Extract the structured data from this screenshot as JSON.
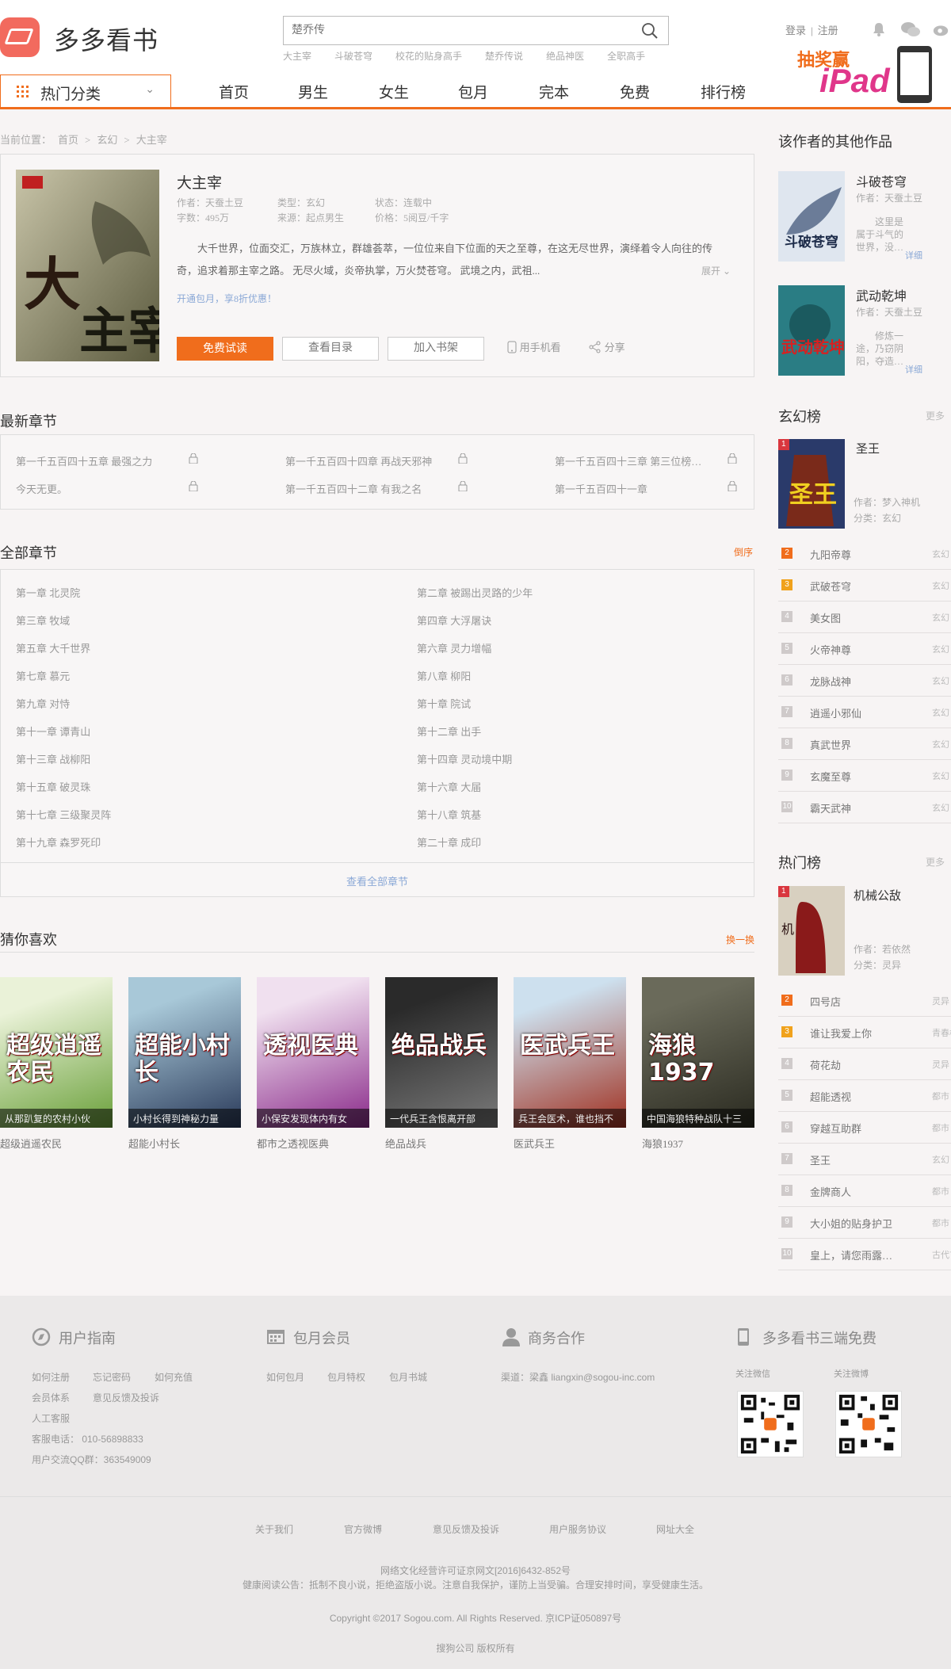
{
  "header": {
    "logo_text": "多多看书",
    "search_placeholder": "楚乔传",
    "hot_words": [
      "大主宰",
      "斗破苍穹",
      "校花的贴身高手",
      "楚乔传说",
      "绝品神医",
      "全职高手"
    ],
    "login": "登录",
    "register": "注册",
    "promo_text1": "抽奖赢",
    "promo_text2": "iPad"
  },
  "nav": {
    "category_label": "热门分类",
    "items": [
      "首页",
      "男生",
      "女生",
      "包月",
      "完本",
      "免费",
      "排行榜"
    ]
  },
  "breadcrumb": [
    "当前位置：",
    "首页",
    ">",
    "玄幻",
    ">",
    "大主宰"
  ],
  "book": {
    "title": "大主宰",
    "author": "作者：天蚕土豆",
    "type": "类型：玄幻",
    "status": "状态：连载中",
    "words": "字数：495万",
    "source": "来源：起点男生",
    "price": "价格：5阅豆/千字",
    "intro": "大千世界，位面交汇，万族林立，群雄荟萃，一位位来自下位面的天之至尊，在这无尽世界，演绎着令人向往的传奇，追求着那主宰之路。        无尽火域，炎帝执掌，万火焚苍穹。        武境之内，武祖...",
    "expand": "展开",
    "promo": "开通包月，享8折优惠！",
    "btn_read": "免费试读",
    "btn_catalog": "查看目录",
    "btn_shelf": "加入书架",
    "btn_phone": "用手机看",
    "btn_share": "分享"
  },
  "latest": {
    "heading": "最新章节",
    "items": [
      "第一千五百四十五章 最强之力",
      "第一千五百四十四章 再战天邪神",
      "第一千五百四十三章 第三位榜…",
      "今天无更。",
      "第一千五百四十二章 有我之名",
      "第一千五百四十一章"
    ]
  },
  "all": {
    "heading": "全部章节",
    "order": "倒序",
    "chapters": [
      "第一章 北灵院",
      "第二章 被踢出灵路的少年",
      "第三章 牧域",
      "第四章 大浮屠诀",
      "第五章 大千世界",
      "第六章 灵力增幅",
      "第七章 慕元",
      "第八章 柳阳",
      "第九章 对恃",
      "第十章 院试",
      "第十一章 谭青山",
      "第十二章 出手",
      "第十三章 战柳阳",
      "第十四章 灵动境中期",
      "第十五章 破灵珠",
      "第十六章 大届",
      "第十七章 三级聚灵阵",
      "第十八章 筑基",
      "第十九章 森罗死印",
      "第二十章 成印"
    ],
    "view_all": "查看全部章节"
  },
  "guess": {
    "heading": "猜你喜欢",
    "refresh": "换一换",
    "books": [
      {
        "name": "超级逍遥农民",
        "cap": "从那趴复的农村小伙",
        "cover_text": "超级逍遥农民"
      },
      {
        "name": "超能小村长",
        "cap": "小村长得到神秘力量",
        "cover_text": "超能小村长"
      },
      {
        "name": "都市之透视医典",
        "cap": "小保安发现体内有女",
        "cover_text": "透视医典"
      },
      {
        "name": "绝品战兵",
        "cap": "一代兵王含恨离开部",
        "cover_text": "绝品战兵"
      },
      {
        "name": "医武兵王",
        "cap": "兵王会医术，谁也挡不",
        "cover_text": "医武兵王"
      },
      {
        "name": "海狼1937",
        "cap": "中国海狼特种战队十三",
        "cover_text": "海狼1937"
      }
    ]
  },
  "sidebar": {
    "other_heading": "该作者的其他作品",
    "other": [
      {
        "title": "斗破苍穹",
        "author": "作者：天蚕土豆",
        "desc": "这里是属于斗气的世界，没…",
        "detail": "详细"
      },
      {
        "title": "武动乾坤",
        "author": "作者：天蚕土豆",
        "desc": "修炼一途，乃窃阴阳，夺造…",
        "detail": "详细"
      }
    ],
    "xuanhuan_heading": "玄幻榜",
    "more": "更多",
    "xuanhuan_top": {
      "rank": "1",
      "title": "圣王",
      "author": "作者：梦入神机",
      "cat": "分类：玄幻"
    },
    "xuanhuan": [
      {
        "n": "2",
        "t": "九阳帝尊",
        "c": "玄幻"
      },
      {
        "n": "3",
        "t": "武破苍穹",
        "c": "玄幻"
      },
      {
        "n": "4",
        "t": "美女图",
        "c": "玄幻"
      },
      {
        "n": "5",
        "t": "火帝神尊",
        "c": "玄幻"
      },
      {
        "n": "6",
        "t": "龙脉战神",
        "c": "玄幻"
      },
      {
        "n": "7",
        "t": "逍遥小邪仙",
        "c": "玄幻"
      },
      {
        "n": "8",
        "t": "真武世界",
        "c": "玄幻"
      },
      {
        "n": "9",
        "t": "玄魔至尊",
        "c": "玄幻"
      },
      {
        "n": "10",
        "t": "霸天武神",
        "c": "玄幻"
      }
    ],
    "hot_heading": "热门榜",
    "hot_top": {
      "rank": "1",
      "title": "机械公敌",
      "author": "作者：若依然",
      "cat": "分类：灵异"
    },
    "hot": [
      {
        "n": "2",
        "t": "四号店",
        "c": "灵异"
      },
      {
        "n": "3",
        "t": "谁让我爱上你",
        "c": "青春校园"
      },
      {
        "n": "4",
        "t": "荷花劫",
        "c": "灵异"
      },
      {
        "n": "5",
        "t": "超能透视",
        "c": "都市"
      },
      {
        "n": "6",
        "t": "穿越互助群",
        "c": "都市"
      },
      {
        "n": "7",
        "t": "圣王",
        "c": "玄幻"
      },
      {
        "n": "8",
        "t": "金牌商人",
        "c": "都市"
      },
      {
        "n": "9",
        "t": "大小姐的贴身护卫",
        "c": "都市"
      },
      {
        "n": "10",
        "t": "皇上，请您雨露…",
        "c": "古代言情"
      }
    ]
  },
  "footer": {
    "guide": {
      "h": "用户指南",
      "links": [
        "如何注册",
        "忘记密码",
        "如何充值",
        "会员体系",
        "意见反馈及投诉",
        "人工客服"
      ],
      "phone": "客服电话：  010-56898833",
      "qq": "用户交流QQ群：363549009"
    },
    "member": {
      "h": "包月会员",
      "links": [
        "如何包月",
        "包月特权",
        "包月书城"
      ]
    },
    "biz": {
      "h": "商务合作",
      "contact": "渠道：梁鑫 liangxin@sogou-inc.com"
    },
    "app": {
      "h": "多多看书三端免费",
      "wechat": "关注微信",
      "weibo": "关注微博"
    },
    "bottom_links": [
      "关于我们",
      "官方微博",
      "意见反馈及投诉",
      "用户服务协议",
      "网址大全"
    ],
    "license": "网络文化经营许可证京网文[2016]6432-852号",
    "notice": "健康阅读公告：抵制不良小说，拒绝盗版小说。注意自我保护，谨防上当受骗。合理安排时间，享受健康生活。",
    "copyright": "Copyright ©2017 Sogou.com. All Rights Reserved. 京ICP证050897号",
    "company": "搜狗公司 版权所有"
  },
  "colors": {
    "accent": "#f06d1c",
    "rank1": "#d9363e",
    "rank2": "#f06d1c",
    "rank3": "#f0a21c",
    "rankN": "#cfcaca"
  }
}
